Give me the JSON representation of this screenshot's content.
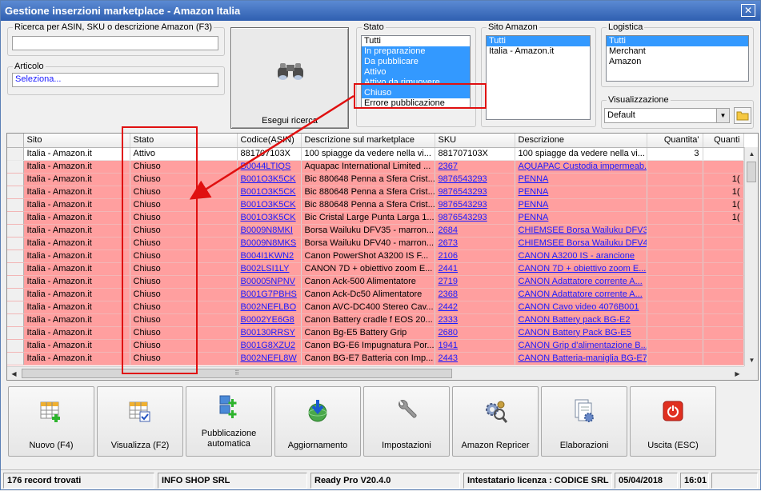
{
  "window": {
    "title": "Gestione inserzioni marketplace - Amazon Italia",
    "close_glyph": "✕"
  },
  "search": {
    "label": "Ricerca per ASIN, SKU o descrizione Amazon (F3)",
    "value": ""
  },
  "articolo": {
    "label": "Articolo",
    "value": "Seleziona..."
  },
  "search_button": {
    "label": "Esegui ricerca"
  },
  "stato": {
    "label": "Stato",
    "options": [
      {
        "label": "Tutti",
        "selected": false
      },
      {
        "label": "In preparazione",
        "selected": true
      },
      {
        "label": "Da pubblicare",
        "selected": true
      },
      {
        "label": "Attivo",
        "selected": true
      },
      {
        "label": "Attivo da rimuovere",
        "selected": true
      },
      {
        "label": "Chiuso",
        "selected": true
      },
      {
        "label": "Errore pubblicazione",
        "selected": false
      }
    ]
  },
  "sito": {
    "label": "Sito Amazon",
    "options": [
      {
        "label": "Tutti",
        "selected": true
      },
      {
        "label": "Italia - Amazon.it",
        "selected": false
      }
    ]
  },
  "logistica": {
    "label": "Logistica",
    "options": [
      {
        "label": "Tutti",
        "selected": true
      },
      {
        "label": "Merchant",
        "selected": false
      },
      {
        "label": "Amazon",
        "selected": false
      }
    ]
  },
  "visualizzazione": {
    "label": "Visualizzazione",
    "value": "Default"
  },
  "grid": {
    "columns": [
      "Sito",
      "Stato",
      "Codice(ASIN)",
      "Descrizione sul marketplace",
      "SKU",
      "Descrizione",
      "Quantita'",
      "Quanti"
    ],
    "rows": [
      {
        "status_color": "white",
        "cells": [
          "Italia - Amazon.it",
          "Attivo",
          "881707103X",
          "100 spiagge da vedere nella vi...",
          "881707103X",
          "100 spiagge da vedere nella vi...",
          "3",
          ""
        ]
      },
      {
        "status_color": "red",
        "cells": [
          "Italia - Amazon.it",
          "Chiuso",
          "B0044LTIQS",
          "Aquapac International Limited ...",
          "2367",
          "AQUAPAC Custodia impermeab...",
          "",
          ""
        ]
      },
      {
        "status_color": "red",
        "cells": [
          "Italia - Amazon.it",
          "Chiuso",
          "B001O3K5CK",
          "Bic 880648 Penna a Sfera Crist...",
          "9876543293",
          "PENNA",
          "",
          "1("
        ]
      },
      {
        "status_color": "red",
        "cells": [
          "Italia - Amazon.it",
          "Chiuso",
          "B001O3K5CK",
          "Bic 880648 Penna a Sfera Crist...",
          "9876543293",
          "PENNA",
          "",
          "1("
        ]
      },
      {
        "status_color": "red",
        "cells": [
          "Italia - Amazon.it",
          "Chiuso",
          "B001O3K5CK",
          "Bic 880648 Penna a Sfera Crist...",
          "9876543293",
          "PENNA",
          "",
          "1("
        ]
      },
      {
        "status_color": "red",
        "cells": [
          "Italia - Amazon.it",
          "Chiuso",
          "B001O3K5CK",
          "Bic Cristal Large Punta Larga 1...",
          "9876543293",
          "PENNA",
          "",
          "1("
        ]
      },
      {
        "status_color": "red",
        "cells": [
          "Italia - Amazon.it",
          "Chiuso",
          "B0009N8MKI",
          "Borsa Wailuku DFV35 - marron...",
          "2684",
          "CHIEMSEE Borsa Wailuku DFV3...",
          "",
          ""
        ]
      },
      {
        "status_color": "red",
        "cells": [
          "Italia - Amazon.it",
          "Chiuso",
          "B0009N8MKS",
          "Borsa Wailuku DFV40 - marron...",
          "2673",
          "CHIEMSEE Borsa Wailuku DFV4...",
          "",
          ""
        ]
      },
      {
        "status_color": "red",
        "cells": [
          "Italia - Amazon.it",
          "Chiuso",
          "B004I1KWN2",
          "Canon PowerShot A3200 IS F...",
          "2106",
          "CANON A3200 IS - arancione",
          "",
          ""
        ]
      },
      {
        "status_color": "red",
        "cells": [
          "Italia - Amazon.it",
          "Chiuso",
          "B002LSI1LY",
          "CANON 7D + obiettivo zoom E...",
          "2441",
          "CANON 7D + obiettivo zoom E...",
          "",
          ""
        ]
      },
      {
        "status_color": "red",
        "cells": [
          "Italia - Amazon.it",
          "Chiuso",
          "B00005NPNV",
          "Canon Ack-500 Alimentatore",
          "2719",
          "CANON Adattatore corrente A...",
          "",
          ""
        ]
      },
      {
        "status_color": "red",
        "cells": [
          "Italia - Amazon.it",
          "Chiuso",
          "B001G7PBHS",
          "Canon Ack-Dc50 Alimentatore",
          "2368",
          "CANON Adattatore corrente A...",
          "",
          ""
        ]
      },
      {
        "status_color": "red",
        "cells": [
          "Italia - Amazon.it",
          "Chiuso",
          "B002NEFLBO",
          "Canon AVC-DC400 Stereo Cav...",
          "2442",
          "CANON Cavo video 4076B001",
          "",
          ""
        ]
      },
      {
        "status_color": "red",
        "cells": [
          "Italia - Amazon.it",
          "Chiuso",
          "B0002YE6G8",
          "Canon Battery cradle f EOS 20...",
          "2333",
          "CANON Battery pack BG-E2",
          "",
          ""
        ]
      },
      {
        "status_color": "red",
        "cells": [
          "Italia - Amazon.it",
          "Chiuso",
          "B00130RRSY",
          "Canon Bg-E5 Battery Grip",
          "2680",
          "CANON Battery Pack BG-E5",
          "",
          ""
        ]
      },
      {
        "status_color": "red",
        "cells": [
          "Italia - Amazon.it",
          "Chiuso",
          "B001G8XZU2",
          "Canon BG-E6 Impugnatura Por...",
          "1941",
          "CANON Grip d'alimentazione B...",
          "",
          ""
        ]
      },
      {
        "status_color": "red",
        "cells": [
          "Italia - Amazon.it",
          "Chiuso",
          "B002NEFL8W",
          "Canon BG-E7 Batteria con Imp...",
          "2443",
          "CANON Batteria-maniglia BG-E7",
          "",
          ""
        ]
      }
    ]
  },
  "buttons": [
    {
      "name": "nuovo-button",
      "label": "Nuovo (F4)",
      "icon": "new-grid-icon"
    },
    {
      "name": "visualizza-button",
      "label": "Visualizza (F2)",
      "icon": "view-grid-icon"
    },
    {
      "name": "pubblicazione-button",
      "label": "Pubblicazione automatica",
      "icon": "publish-icon"
    },
    {
      "name": "aggiornamento-button",
      "label": "Aggiornamento",
      "icon": "download-globe-icon"
    },
    {
      "name": "impostazioni-button",
      "label": "Impostazioni",
      "icon": "wrench-icon"
    },
    {
      "name": "amazon-repricer-button",
      "label": "Amazon Repricer",
      "icon": "gears-magnifier-icon"
    },
    {
      "name": "elaborazioni-button",
      "label": "Elaborazioni",
      "icon": "documents-gear-icon"
    },
    {
      "name": "uscita-button",
      "label": "Uscita (ESC)",
      "icon": "power-icon"
    }
  ],
  "statusbar": {
    "records": "176 record trovati",
    "company": "INFO SHOP SRL",
    "version": "Ready Pro V20.4.0",
    "license": "Intestatario licenza : CODICE SRL",
    "date": "05/04/2018",
    "time": "16:01"
  },
  "colors": {
    "title_bar": "#2f5fb0",
    "selection": "#3399ff",
    "closed_row": "#ff9f9f",
    "link": "#1a1aff",
    "annotation": "#e01010"
  }
}
